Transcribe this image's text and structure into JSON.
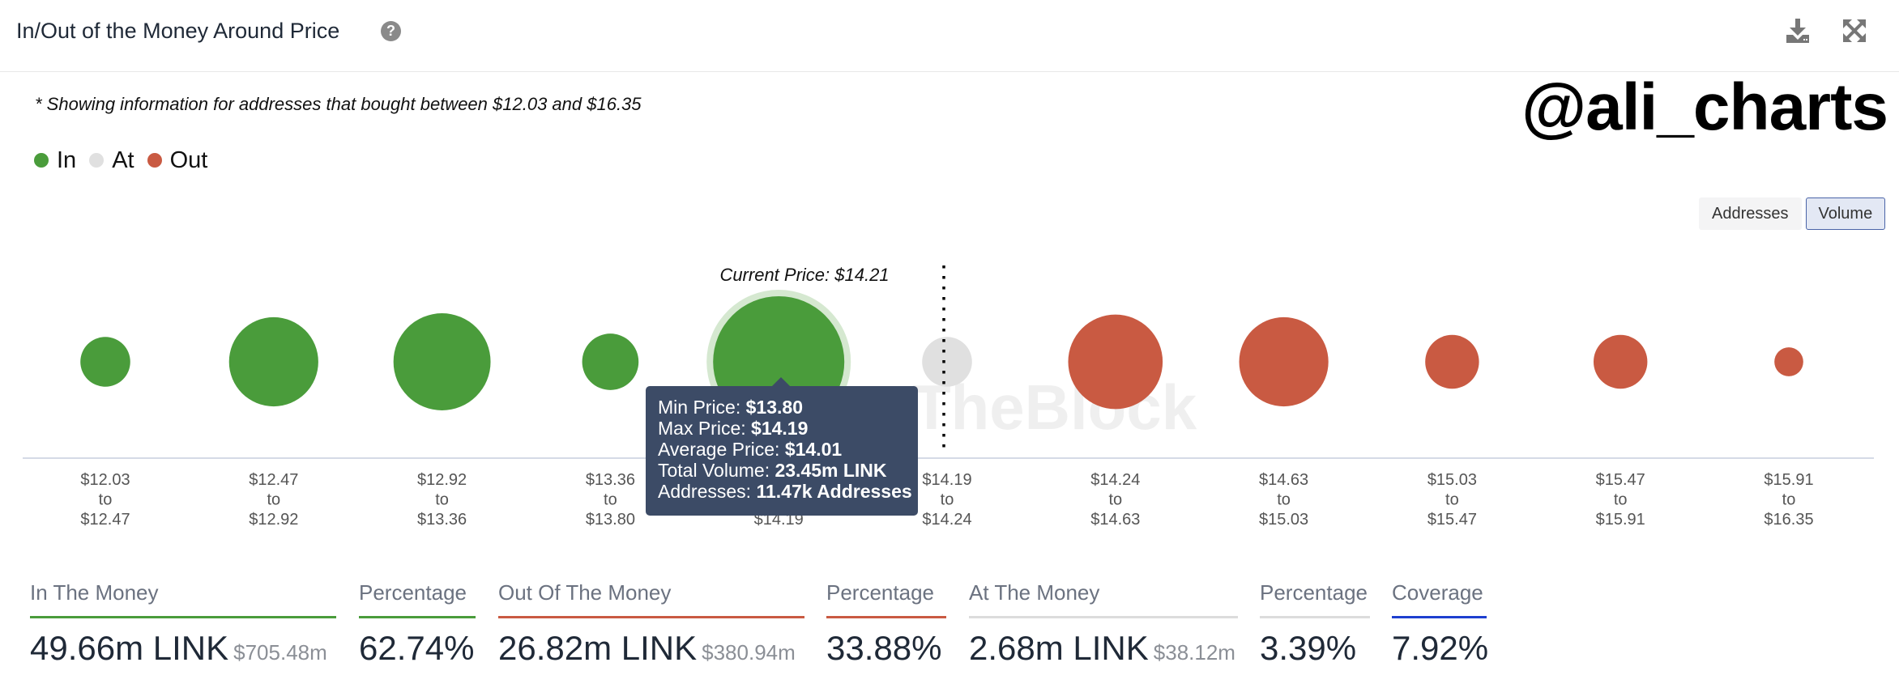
{
  "header": {
    "title": "In/Out of the Money Around Price",
    "help_icon": "question-circle-icon",
    "download_icon": "download-icon",
    "expand_icon": "expand-icon"
  },
  "subtitle": "* Showing information for addresses that bought between $12.03 and $16.35",
  "watermark": "@ali_charts",
  "brand_watermark": "TheBlock",
  "legend": [
    {
      "label": "In",
      "color": "#4a9c3b"
    },
    {
      "label": "At",
      "color": "#e0e0e0"
    },
    {
      "label": "Out",
      "color": "#c95a42"
    }
  ],
  "toggle": {
    "options": [
      "Addresses",
      "Volume"
    ],
    "selected": "Volume"
  },
  "colors": {
    "in": "#4a9c3b",
    "in_halo": "#d5e8d0",
    "at": "#e0e0e0",
    "out": "#c95a42",
    "coverage": "#1e3fd0",
    "tooltip_bg": "#3c4b66"
  },
  "chart_data": {
    "type": "bubble",
    "title": "In/Out of the Money Around Price",
    "metric": "Volume",
    "current_price_label": "Current Price: $14.21",
    "current_price": 14.21,
    "categories": [
      {
        "from": "$12.03",
        "to": "$12.47",
        "status": "in",
        "relative_size": 0.38
      },
      {
        "from": "$12.47",
        "to": "$12.92",
        "status": "in",
        "relative_size": 0.68
      },
      {
        "from": "$12.92",
        "to": "$13.36",
        "status": "in",
        "relative_size": 0.74
      },
      {
        "from": "$13.36",
        "to": "$13.80",
        "status": "in",
        "relative_size": 0.43
      },
      {
        "from": "$13.80",
        "to": "$14.19",
        "status": "in",
        "relative_size": 1.0,
        "highlighted": true
      },
      {
        "from": "$14.19",
        "to": "$14.24",
        "status": "at",
        "relative_size": 0.38
      },
      {
        "from": "$14.24",
        "to": "$14.63",
        "status": "out",
        "relative_size": 0.72
      },
      {
        "from": "$14.63",
        "to": "$15.03",
        "status": "out",
        "relative_size": 0.68
      },
      {
        "from": "$15.03",
        "to": "$15.47",
        "status": "out",
        "relative_size": 0.41
      },
      {
        "from": "$15.47",
        "to": "$15.91",
        "status": "out",
        "relative_size": 0.41
      },
      {
        "from": "$15.91",
        "to": "$16.35",
        "status": "out",
        "relative_size": 0.22
      }
    ],
    "tooltip": {
      "bucket_index": 4,
      "rows": [
        {
          "label": "Min Price: ",
          "value": "$13.80"
        },
        {
          "label": "Max Price: ",
          "value": "$14.19"
        },
        {
          "label": "Average Price: ",
          "value": "$14.01"
        },
        {
          "label": "Total Volume: ",
          "value": "23.45m LINK"
        },
        {
          "label": "Addresses: ",
          "value": "11.47k Addresses"
        }
      ]
    }
  },
  "stats": [
    {
      "label": "In The Money",
      "value": "49.66m LINK",
      "sub": "$705.48m",
      "color": "#4a9c3b"
    },
    {
      "label": "Percentage",
      "value": "62.74%",
      "sub": "",
      "color": "#4a9c3b"
    },
    {
      "label": "Out Of The Money",
      "value": "26.82m LINK",
      "sub": "$380.94m",
      "color": "#c95a42"
    },
    {
      "label": "Percentage",
      "value": "33.88%",
      "sub": "",
      "color": "#c95a42"
    },
    {
      "label": "At The Money",
      "value": "2.68m LINK",
      "sub": "$38.12m",
      "color": "#dcdcdc"
    },
    {
      "label": "Percentage",
      "value": "3.39%",
      "sub": "",
      "color": "#dcdcdc"
    },
    {
      "label": "Coverage",
      "value": "7.92%",
      "sub": "",
      "color": "#1e3fd0"
    }
  ]
}
